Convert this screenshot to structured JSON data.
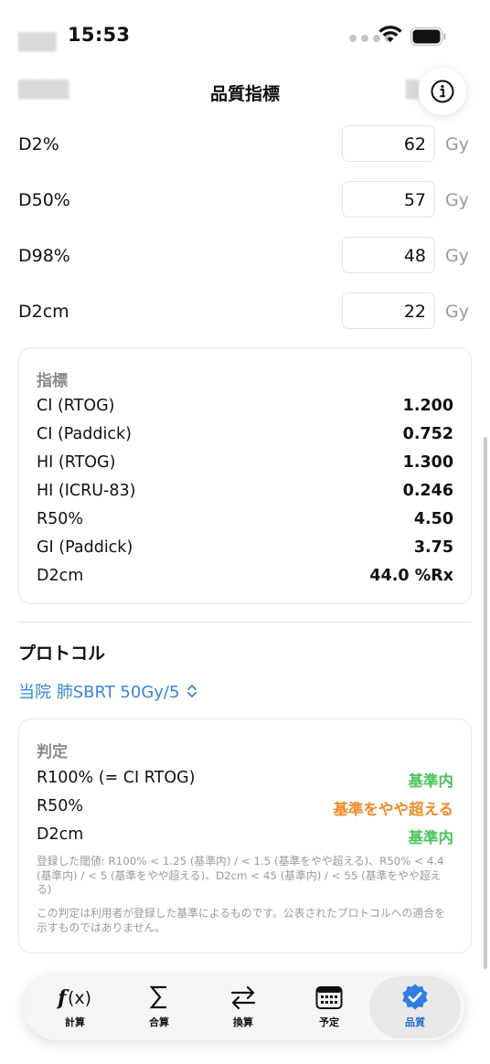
{
  "status": {
    "time": "15:53"
  },
  "nav": {
    "title": "品質指標"
  },
  "doses": [
    {
      "label": "D2%",
      "value": "62",
      "unit": "Gy"
    },
    {
      "label": "D50%",
      "value": "57",
      "unit": "Gy"
    },
    {
      "label": "D98%",
      "value": "48",
      "unit": "Gy"
    },
    {
      "label": "D2cm",
      "value": "22",
      "unit": "Gy"
    }
  ],
  "metrics": {
    "header": "指標",
    "rows": [
      {
        "label": "CI (RTOG)",
        "value": "1.200"
      },
      {
        "label": "CI (Paddick)",
        "value": "0.752"
      },
      {
        "label": "HI (RTOG)",
        "value": "1.300"
      },
      {
        "label": "HI (ICRU-83)",
        "value": "0.246"
      },
      {
        "label": "R50%",
        "value": "4.50"
      },
      {
        "label": "GI (Paddick)",
        "value": "3.75"
      },
      {
        "label": "D2cm",
        "value": "44.0 %Rx"
      }
    ]
  },
  "protocol": {
    "title": "プロトコル",
    "selected": "当院 肺SBRT 50Gy/5"
  },
  "judgement": {
    "header": "判定",
    "rows": [
      {
        "label": "R100% (= CI RTOG)",
        "result": "基準内"
      },
      {
        "label": "R50%",
        "result": "基準をやや超える"
      },
      {
        "label": "D2cm",
        "result": "基準内"
      }
    ],
    "thresholds": "登録した閾値: R100% < 1.25 (基準内) / < 1.5 (基準をやや超える)、R50% < 4.4 (基準内) / < 5 (基準をやや超える)、D2cm < 45 (基準内) / < 55 (基準をやや超える)",
    "disclaimer": "この判定は利用者が登録した基準によるものです。公表されたプロトコルへの適合を示すものではありません。"
  },
  "colors": {
    "accent": "#3a86d6",
    "ok": "#4cc35a",
    "warn": "#f08a2a"
  },
  "tabs": [
    {
      "label": "計算",
      "icon": "function-icon"
    },
    {
      "label": "合算",
      "icon": "sum-icon"
    },
    {
      "label": "換算",
      "icon": "arrows-swap-icon"
    },
    {
      "label": "予定",
      "icon": "calendar-icon"
    },
    {
      "label": "品質",
      "icon": "checkmark-seal-icon",
      "active": true
    }
  ]
}
